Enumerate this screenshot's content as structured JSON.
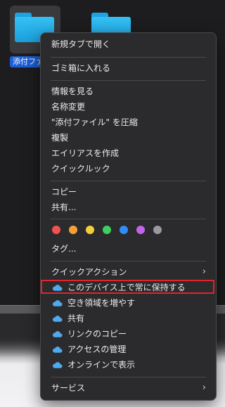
{
  "desktop": {
    "folder_label": "添付ファ"
  },
  "menu": {
    "items": [
      {
        "label": "新規タブで開く"
      },
      {
        "label": "ゴミ箱に入れる"
      },
      {
        "label": "情報を見る"
      },
      {
        "label": "名称変更"
      },
      {
        "label": "\"添付ファイル\" を圧縮"
      },
      {
        "label": "複製"
      },
      {
        "label": "エイリアスを作成"
      },
      {
        "label": "クイックルック"
      },
      {
        "label": "コピー"
      },
      {
        "label": "共有..."
      },
      {
        "label": "タグ..."
      },
      {
        "label": "クイックアクション",
        "submenu": true
      },
      {
        "label": "このデバイス上で常に保持する",
        "icon": "onedrive-cloud-icon",
        "highlighted": true
      },
      {
        "label": "空き領域を増やす",
        "icon": "onedrive-cloud-icon"
      },
      {
        "label": "共有",
        "icon": "onedrive-cloud-icon"
      },
      {
        "label": "リンクのコピー",
        "icon": "onedrive-cloud-icon"
      },
      {
        "label": "アクセスの管理",
        "icon": "onedrive-cloud-icon"
      },
      {
        "label": "オンラインで表示",
        "icon": "onedrive-cloud-icon"
      },
      {
        "label": "サービス",
        "submenu": true
      }
    ],
    "chevron": "›",
    "tag_colors": [
      {
        "name": "red",
        "color": "#f0524f"
      },
      {
        "name": "orange",
        "color": "#f5a13a"
      },
      {
        "name": "yellow",
        "color": "#f4cf3a"
      },
      {
        "name": "green",
        "color": "#3fcf5c"
      },
      {
        "name": "blue",
        "color": "#2f8df5"
      },
      {
        "name": "purple",
        "color": "#c165e6"
      },
      {
        "name": "gray",
        "color": "#9a9a9e"
      }
    ],
    "highlight_color": "#e0242a"
  }
}
